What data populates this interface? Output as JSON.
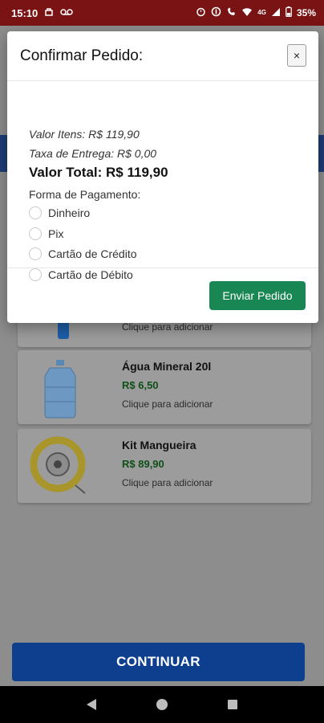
{
  "status_bar": {
    "time": "15:10",
    "network": "4G",
    "battery": "35%"
  },
  "products": [
    {
      "name": "",
      "price": "",
      "hint": "Clique para adicionar",
      "icon": "water-bottle-icon"
    },
    {
      "name": "Água Mineral 20l",
      "price": "R$ 6,50",
      "hint": "Clique para adicionar",
      "icon": "water-jug-icon"
    },
    {
      "name": "Kit Mangueira",
      "price": "R$ 89,90",
      "hint": "Clique para adicionar",
      "icon": "gas-hose-kit-icon"
    }
  ],
  "continue_button": "CONTINUAR",
  "modal": {
    "title": "Confirmar Pedido:",
    "close_label": "×",
    "items_value": "Valor Itens: R$ 119,90",
    "delivery_fee": "Taxa de Entrega: R$ 0,00",
    "total": "Valor Total: R$ 119,90",
    "payment_label": "Forma de Pagamento:",
    "payment_options": [
      "Dinheiro",
      "Pix",
      "Cartão de Crédito",
      "Cartão de Débito"
    ],
    "selected_payment": "",
    "submit_label": "Enviar Pedido"
  },
  "colors": {
    "status_bar": "#7a1414",
    "primary_blue": "#0e3f8e",
    "success_green": "#198754",
    "price_green": "#0f4f18"
  }
}
